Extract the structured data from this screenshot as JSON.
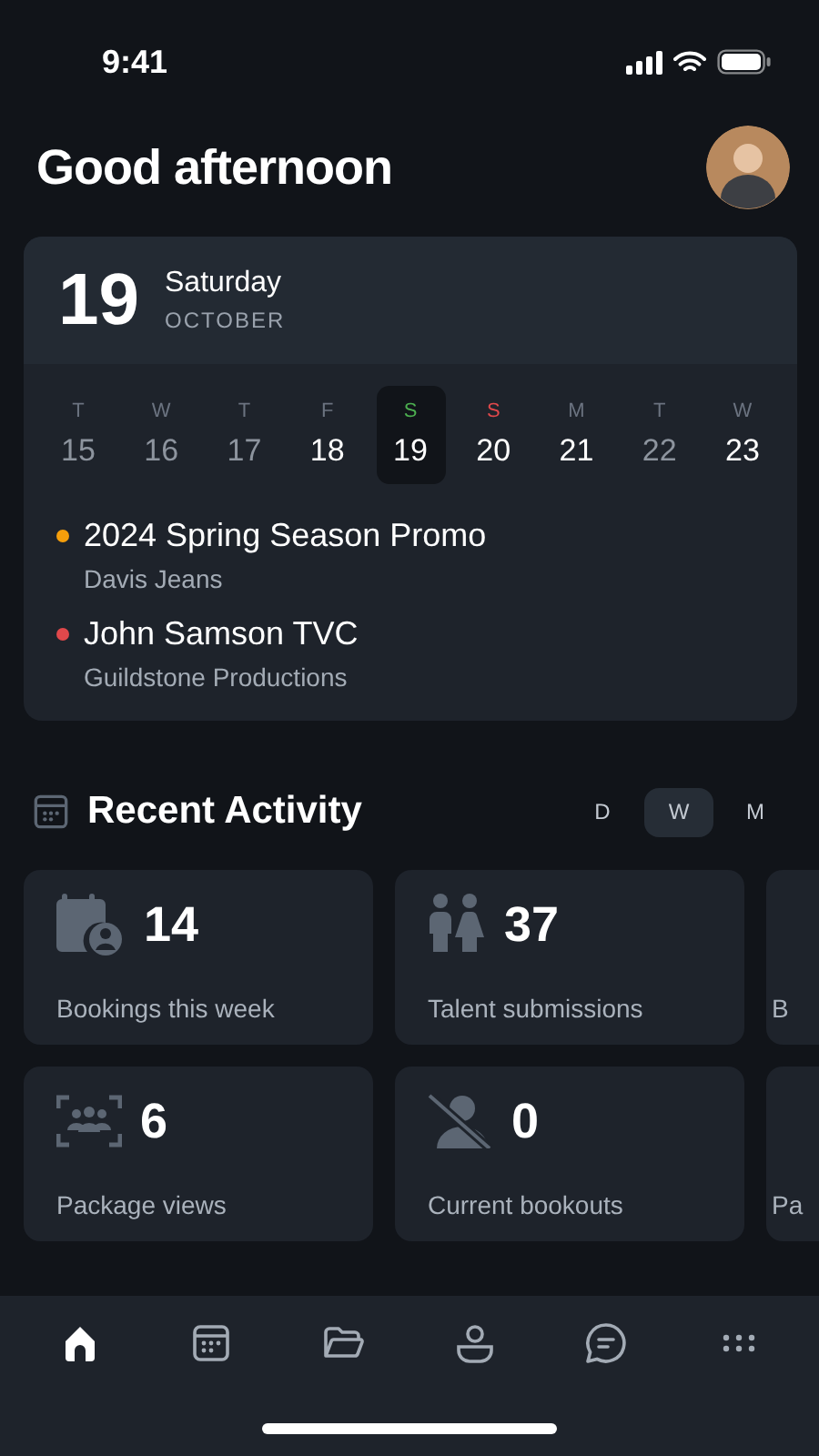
{
  "status_bar": {
    "time": "9:41"
  },
  "header": {
    "greeting": "Good afternoon"
  },
  "calendar": {
    "day_number": "19",
    "weekday": "Saturday",
    "month": "OCTOBER",
    "days": [
      {
        "letter": "T",
        "number": "15",
        "selected": false,
        "muted": true,
        "color": "#6b7380"
      },
      {
        "letter": "W",
        "number": "16",
        "selected": false,
        "muted": true,
        "color": "#6b7380"
      },
      {
        "letter": "T",
        "number": "17",
        "selected": false,
        "muted": true,
        "color": "#6b7380"
      },
      {
        "letter": "F",
        "number": "18",
        "selected": false,
        "muted": false,
        "color": "#6b7380"
      },
      {
        "letter": "S",
        "number": "19",
        "selected": true,
        "muted": false,
        "color": "#4caf50"
      },
      {
        "letter": "S",
        "number": "20",
        "selected": false,
        "muted": false,
        "color": "#e0484b"
      },
      {
        "letter": "M",
        "number": "21",
        "selected": false,
        "muted": false,
        "color": "#6b7380"
      },
      {
        "letter": "T",
        "number": "22",
        "selected": false,
        "muted": true,
        "color": "#6b7380"
      },
      {
        "letter": "W",
        "number": "23",
        "selected": false,
        "muted": false,
        "color": "#6b7380"
      }
    ],
    "events": [
      {
        "title": "2024 Spring Season Promo",
        "client": "Davis Jeans",
        "color": "#f59e0b"
      },
      {
        "title": "John Samson TVC",
        "client": "Guildstone Productions",
        "color": "#e0484b"
      }
    ]
  },
  "recent_activity": {
    "title": "Recent Activity",
    "periods": [
      {
        "label": "D",
        "selected": false
      },
      {
        "label": "W",
        "selected": true
      },
      {
        "label": "M",
        "selected": false
      }
    ],
    "rows": [
      [
        {
          "kind": "bookings",
          "value": "14",
          "label": "Bookings this week"
        },
        {
          "kind": "talent",
          "value": "37",
          "label": "Talent submissions"
        },
        {
          "kind": "cut",
          "label": "B"
        }
      ],
      [
        {
          "kind": "views",
          "value": "6",
          "label": "Package views"
        },
        {
          "kind": "bookouts",
          "value": "0",
          "label": "Current bookouts"
        },
        {
          "kind": "cut",
          "label": "Pa"
        }
      ]
    ]
  },
  "nav": [
    {
      "kind": "home",
      "selected": true
    },
    {
      "kind": "calendar",
      "selected": false
    },
    {
      "kind": "folder",
      "selected": false
    },
    {
      "kind": "person",
      "selected": false
    },
    {
      "kind": "chat",
      "selected": false
    },
    {
      "kind": "more",
      "selected": false
    }
  ]
}
